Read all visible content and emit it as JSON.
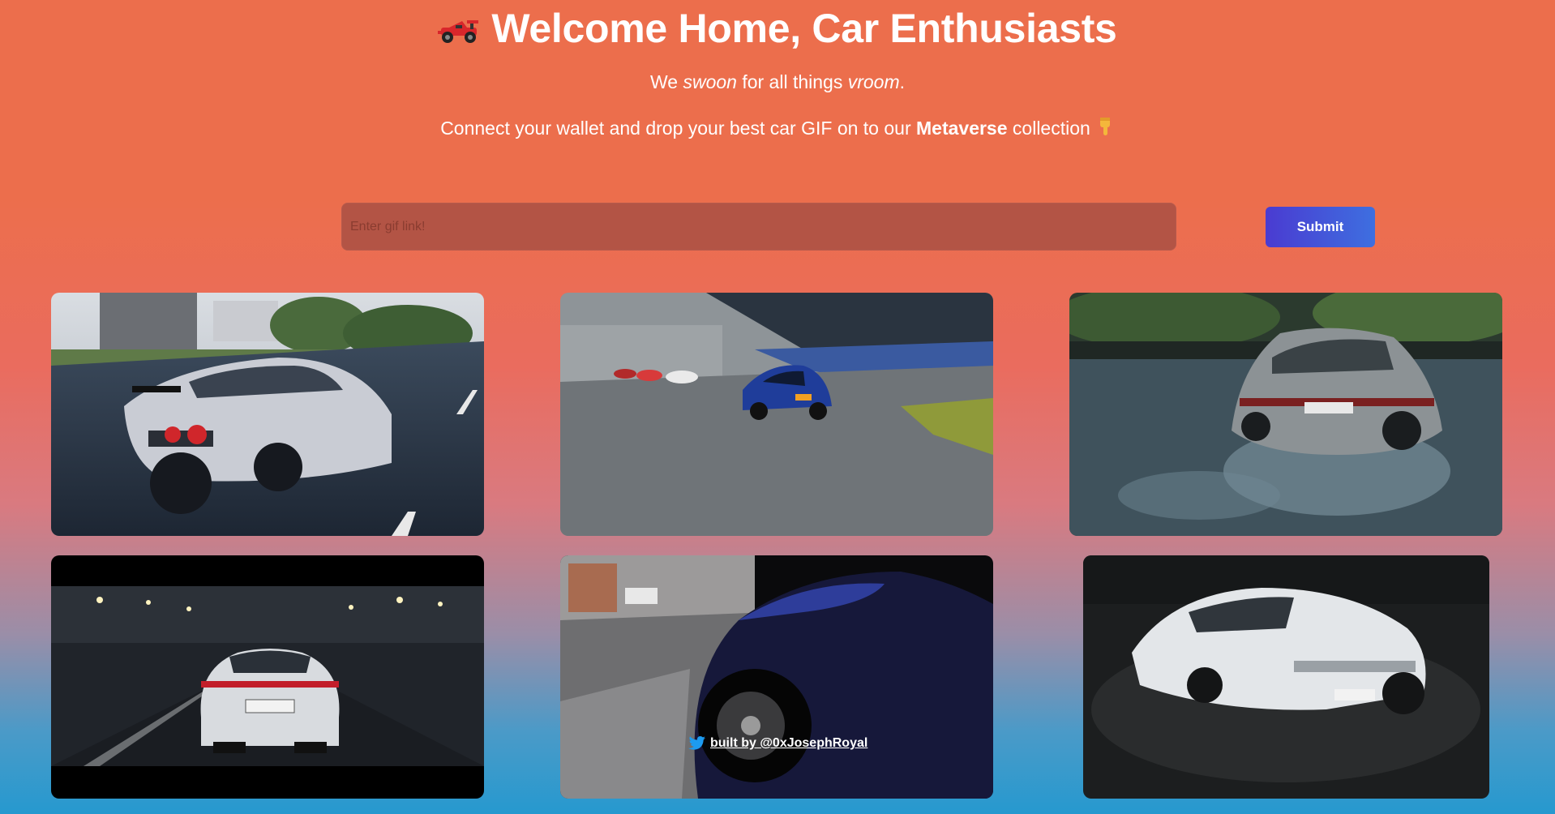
{
  "header": {
    "title": "Welcome Home, Car Enthusiasts",
    "title_icon": "race-car-icon",
    "subtitle": {
      "we": "We ",
      "swoon": "swoon",
      "middle": " for all things ",
      "vroom": "vroom",
      "end": "."
    },
    "description": {
      "lead": "Connect your wallet and drop your best car GIF on to our ",
      "metaverse": "Metaverse",
      "tail": " collection",
      "icon": "pointing-down-icon"
    }
  },
  "form": {
    "input_placeholder": "Enter gif link!",
    "input_value": "",
    "submit_label": "Submit"
  },
  "gallery": {
    "items": [
      {
        "name": "silver-gtr-wet-road-gif"
      },
      {
        "name": "blue-mclaren-track-gif"
      },
      {
        "name": "grey-911-drift-gif"
      },
      {
        "name": "white-panamera-night-gif"
      },
      {
        "name": "dark-blue-car-wheel-gif"
      },
      {
        "name": "white-lamborghini-gif"
      }
    ]
  },
  "footer": {
    "icon": "twitter-icon",
    "text": "built by @0xJosephRoyal"
  },
  "colors": {
    "background_top": "#ec6e4c",
    "background_bottom": "#2699cf",
    "input_bg": "#b35445",
    "button_start": "#4a3bd1",
    "button_end": "#3e6fe0"
  }
}
